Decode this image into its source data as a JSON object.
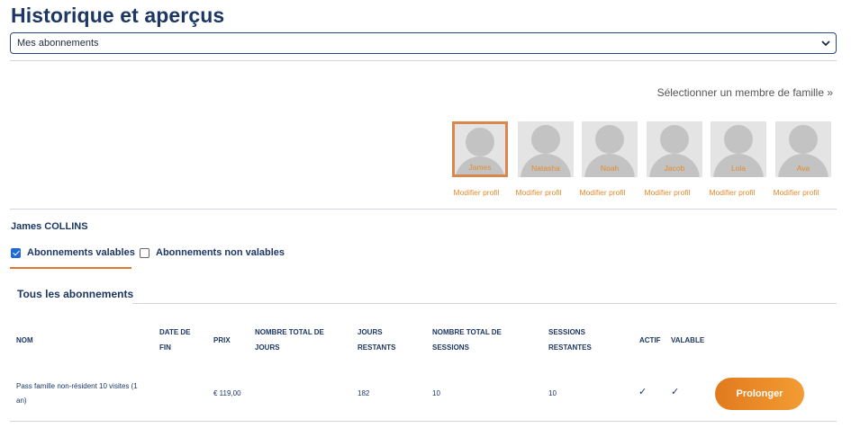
{
  "page_title": "Historique et aperçus",
  "select": {
    "value": "Mes abonnements"
  },
  "family_select_label": "Sélectionner un membre de famille »",
  "family_members": [
    {
      "name": "James",
      "edit_label": "Modifier profil",
      "selected": true
    },
    {
      "name": "Natasha",
      "edit_label": "Modifier profil",
      "selected": false
    },
    {
      "name": "Noah",
      "edit_label": "Modifier profil",
      "selected": false
    },
    {
      "name": "Jacob",
      "edit_label": "Modifier profil",
      "selected": false
    },
    {
      "name": "Lola",
      "edit_label": "Modifier profil",
      "selected": false
    },
    {
      "name": "Ava",
      "edit_label": "Modifier profil",
      "selected": false
    }
  ],
  "user_fullname": "James COLLINS",
  "filters": {
    "valid": {
      "label": "Abonnements valables",
      "checked": true
    },
    "invalid": {
      "label": "Abonnements non valables",
      "checked": false
    }
  },
  "section_title": "Tous les abonnements",
  "table": {
    "headers": {
      "nom": "NOM",
      "date_fin_1": "DATE DE",
      "date_fin_2": "FIN",
      "prix": "PRIX",
      "total_jours_1": "NOMBRE TOTAL DE",
      "total_jours_2": "JOURS",
      "jours_restants_1": "JOURS",
      "jours_restants_2": "RESTANTS",
      "total_sessions_1": "NOMBRE TOTAL DE",
      "total_sessions_2": "SESSIONS",
      "sessions_restantes_1": "SESSIONS",
      "sessions_restantes_2": "RESTANTES",
      "actif": "ACTIF",
      "valable": "VALABLE"
    },
    "rows": [
      {
        "nom_1": "Pass famille non-résident 10 visites (1",
        "nom_2": "an)",
        "date_fin": "",
        "prix": "€ 119,00",
        "total_jours": "",
        "jours_restants": "182",
        "total_sessions": "10",
        "sessions_restantes": "10",
        "actif": "✓",
        "valable": "✓",
        "action_label": "Prolonger"
      }
    ]
  },
  "colors": {
    "brand_navy": "#1c3764",
    "accent_orange": "#e2762b",
    "link_orange": "#e38b2d"
  }
}
